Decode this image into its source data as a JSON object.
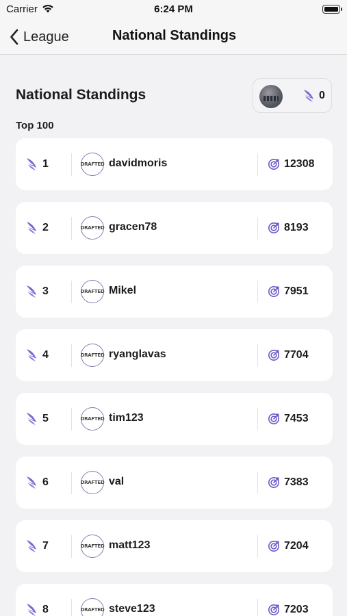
{
  "status_bar": {
    "carrier": "Carrier",
    "time": "6:24 PM"
  },
  "nav": {
    "back_label": "League",
    "title": "National Standings"
  },
  "header": {
    "title": "National Standings",
    "user_count": "0",
    "subheading": "Top 100"
  },
  "avatar_text": "DRAFTED",
  "colors": {
    "accent": "#6a5acd",
    "background": "#f2f2f4",
    "card": "#ffffff"
  },
  "standings": [
    {
      "rank": "1",
      "name": "davidmoris",
      "score": "12308"
    },
    {
      "rank": "2",
      "name": "gracen78",
      "score": "8193"
    },
    {
      "rank": "3",
      "name": "Mikel",
      "score": "7951"
    },
    {
      "rank": "4",
      "name": "ryanglavas",
      "score": "7704"
    },
    {
      "rank": "5",
      "name": "tim123",
      "score": "7453"
    },
    {
      "rank": "6",
      "name": "val",
      "score": "7383"
    },
    {
      "rank": "7",
      "name": "matt123",
      "score": "7204"
    },
    {
      "rank": "8",
      "name": "steve123",
      "score": "7203"
    }
  ]
}
